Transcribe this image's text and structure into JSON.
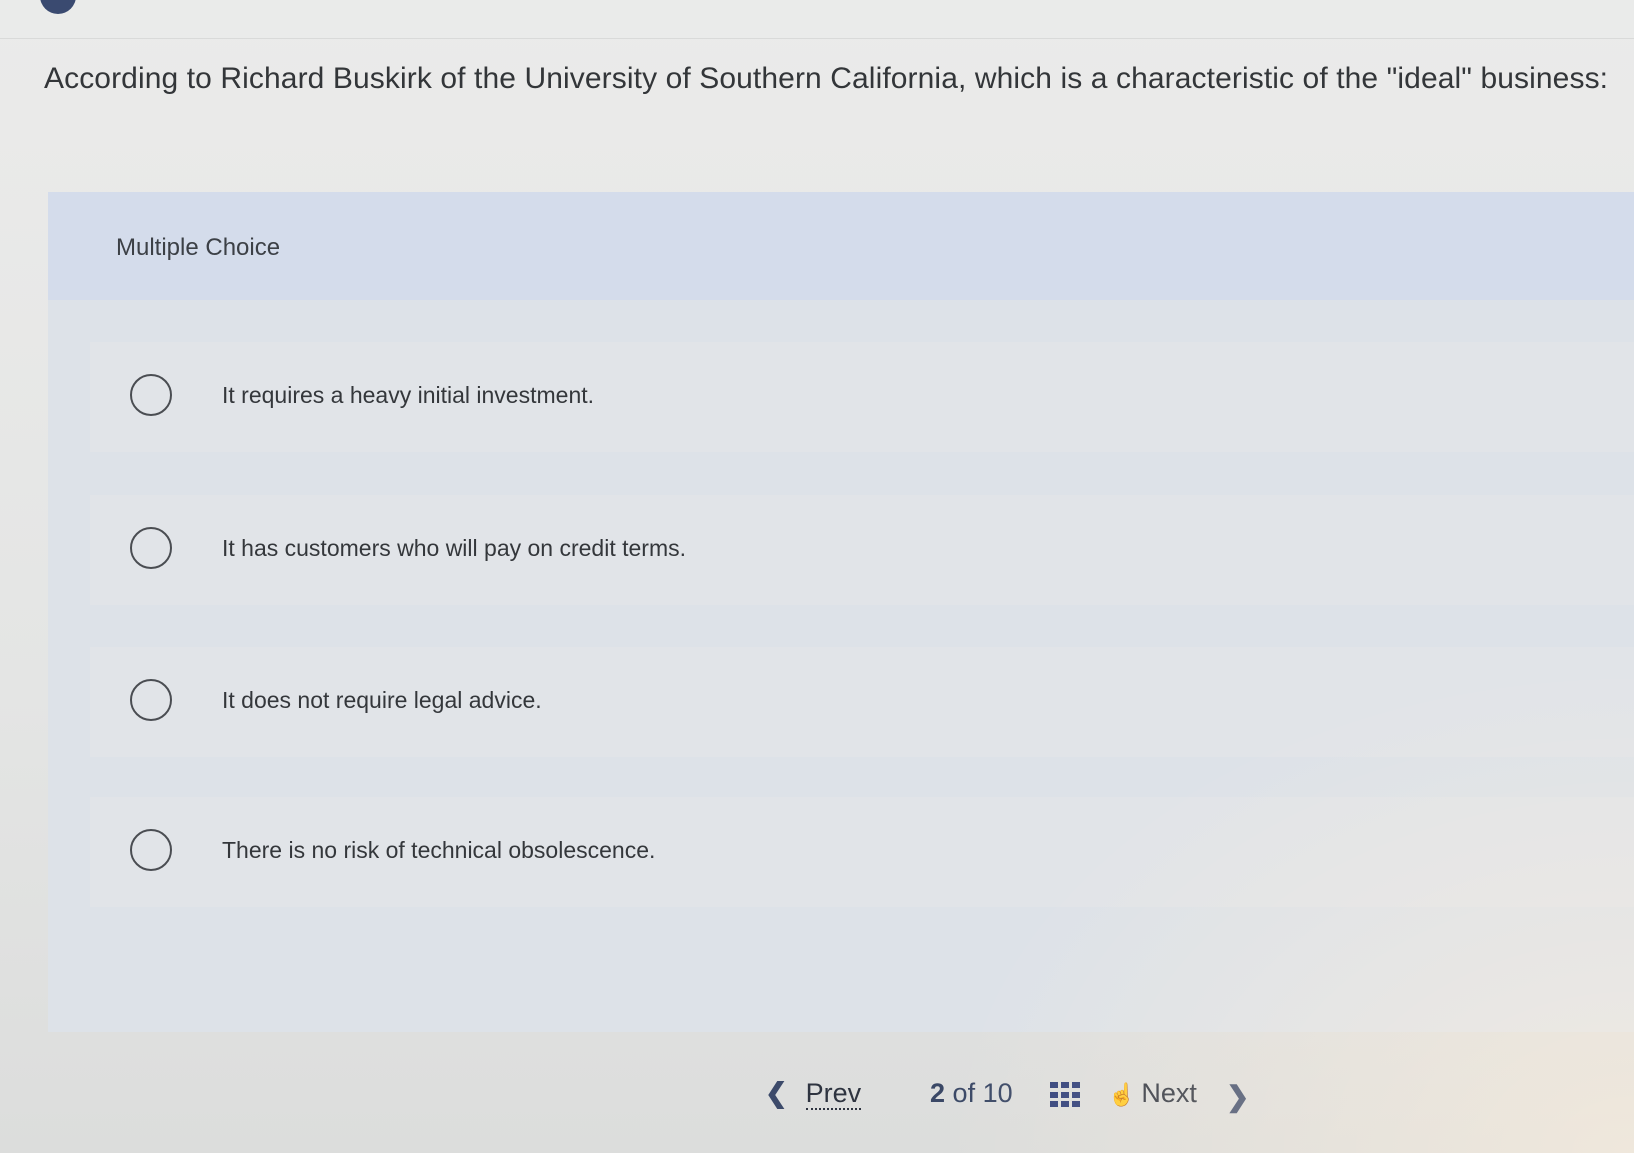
{
  "question": {
    "text": "According to Richard Buskirk of the University of Southern California, which is a characteristic of the \"ideal\" business:"
  },
  "multiple_choice": {
    "label": "Multiple Choice",
    "options": [
      {
        "text": "It requires a heavy initial investment.",
        "selected": false
      },
      {
        "text": "It has customers who will pay on credit terms.",
        "selected": false
      },
      {
        "text": "It does not require legal advice.",
        "selected": false
      },
      {
        "text": "There is no risk of technical obsolescence.",
        "selected": false
      }
    ]
  },
  "navigation": {
    "prev_label": "Prev",
    "current": "2",
    "of_label": "of",
    "total": "10",
    "next_label": "Next",
    "prev_icon": "chevron-left-icon",
    "next_icon": "chevron-right-icon",
    "grid_icon": "question-grid-icon",
    "hand_icon": "pointer-hand-icon"
  },
  "colors": {
    "header_band": "#d4dceb",
    "nav_accent": "#2f3f7a"
  }
}
